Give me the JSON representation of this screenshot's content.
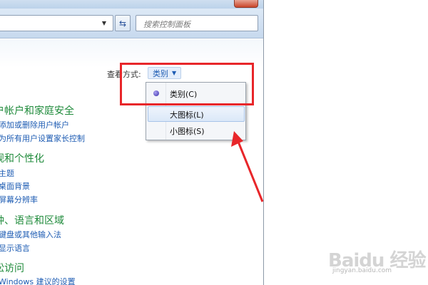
{
  "toolbar": {
    "search_placeholder": "搜索控制面板"
  },
  "view": {
    "label": "查看方式:",
    "value": "类别"
  },
  "view_menu": {
    "items": [
      {
        "label": "类别(C)",
        "selected": true
      },
      {
        "label": "大图标(L)",
        "highlighted": true
      },
      {
        "label": "小图标(S)"
      }
    ]
  },
  "categories": [
    {
      "title": "户帐户和家庭安全",
      "links": [
        "添加或删除用户帐户",
        "为所有用户设置家长控制"
      ]
    },
    {
      "title": "观和个性化",
      "links": [
        "主题",
        "桌面背景",
        "屏幕分辨率"
      ]
    },
    {
      "title": "钟、语言和区域",
      "links": [
        "键盘或其他输入法",
        "显示语言"
      ]
    },
    {
      "title": "松访问",
      "links": [
        "Windows 建议的设置"
      ]
    }
  ],
  "annotation": {
    "color": "#e8262a"
  },
  "watermark": {
    "brand": "Baidu 经验",
    "url": "jingyan.baidu.com"
  }
}
